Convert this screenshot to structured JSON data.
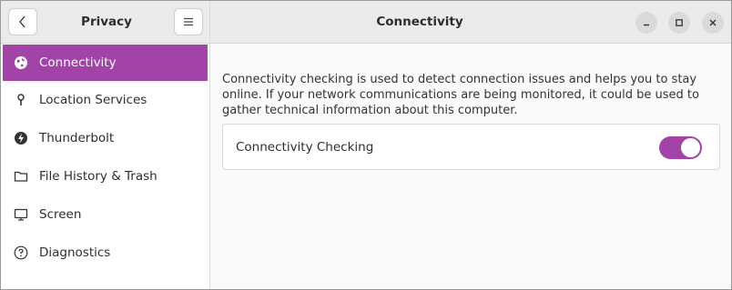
{
  "sidebar": {
    "title": "Privacy",
    "items": [
      {
        "label": "Connectivity",
        "icon": "globe-icon",
        "selected": true
      },
      {
        "label": "Location Services",
        "icon": "location-pin-icon",
        "selected": false
      },
      {
        "label": "Thunderbolt",
        "icon": "thunderbolt-icon",
        "selected": false
      },
      {
        "label": "File History & Trash",
        "icon": "folder-icon",
        "selected": false
      },
      {
        "label": "Screen",
        "icon": "monitor-icon",
        "selected": false
      },
      {
        "label": "Diagnostics",
        "icon": "question-icon",
        "selected": false
      }
    ]
  },
  "header": {
    "title": "Connectivity"
  },
  "main": {
    "description": "Connectivity checking is used to detect connection issues and helps you to stay online. If your network communications are being monitored, it could be used to gather technical information about this computer.",
    "setting": {
      "label": "Connectivity Checking",
      "enabled": true
    }
  },
  "colors": {
    "accent": "#a243a8",
    "header_bg": "#ebebeb"
  }
}
